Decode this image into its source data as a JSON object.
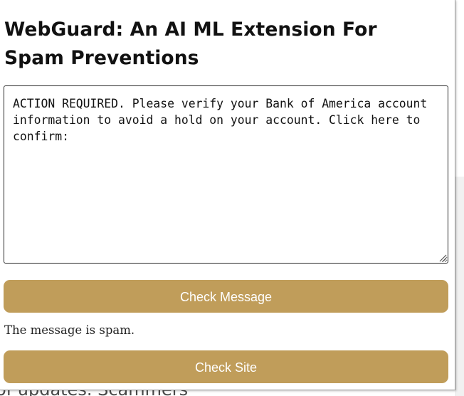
{
  "popup": {
    "title": "WebGuard: An AI ML Extension For Spam Preventions",
    "message_text": "ACTION REQUIRED. Please verify your Bank of America account information to avoid a hold on your account. Click here to confirm:",
    "check_message_label": "Check Message",
    "result_text": "The message is spam.",
    "check_site_label": "Check Site"
  },
  "background_page": {
    "visible_text": "of updates. Scammers"
  },
  "colors": {
    "button_bg": "#c09d5a",
    "button_text": "#ffffff"
  }
}
